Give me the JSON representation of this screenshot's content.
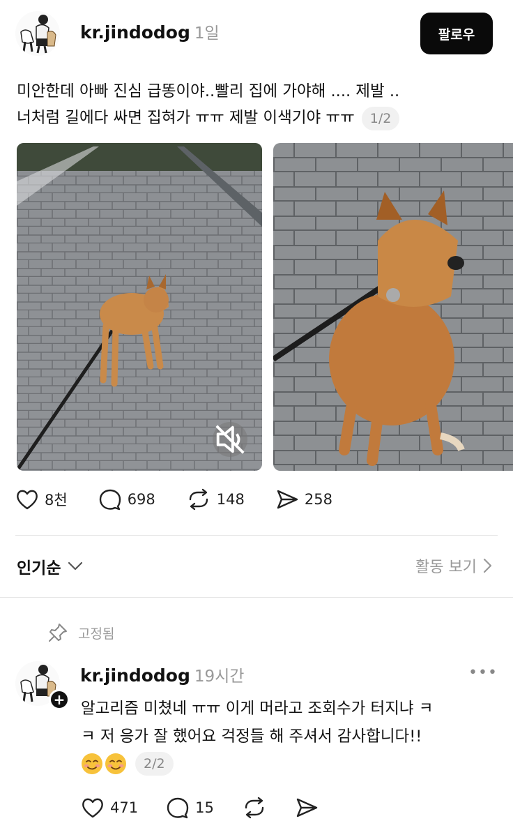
{
  "post": {
    "username": "kr.jindodog",
    "time": "1일",
    "follow_label": "팔로우",
    "text_lines": [
      "미안한데 아빠 진심 급똥이야..빨리 집에 가야해 .... 제발 ..",
      "너처럼 길에다 싸면 집혀가 ㅠㅠ 제발 이색기야 ㅠㅠ"
    ],
    "page_counter": "1/2",
    "actions": {
      "likes": "8천",
      "comments": "698",
      "reposts": "148",
      "shares": "258"
    }
  },
  "sort": {
    "label": "인기순",
    "activity_label": "활동 보기"
  },
  "pinned": {
    "label": "고정됨"
  },
  "reply": {
    "username": "kr.jindodog",
    "time": "19시간",
    "more_label": "•••",
    "text_lines": [
      "알고리즘 미쳤네 ㅠㅠ 이게 머라고 조회수가 터지냐 ㅋ",
      "ㅋ 저 응가 잘 했어요 걱정들 해 주셔서 감사합니다!!"
    ],
    "page_counter": "2/2",
    "plus_badge": "+",
    "actions": {
      "likes": "471",
      "comments": "15"
    }
  },
  "colors": {
    "follow_bg": "#0a0a0a",
    "muted_text": "#999999",
    "divider": "#e6e6e6"
  },
  "icons": [
    "avatar-illustration",
    "mute-icon",
    "heart-icon",
    "comment-icon",
    "repost-icon",
    "send-icon",
    "chevron-down-icon",
    "chevron-right-icon",
    "pin-icon",
    "more-icon",
    "smiling-face-emoji"
  ]
}
